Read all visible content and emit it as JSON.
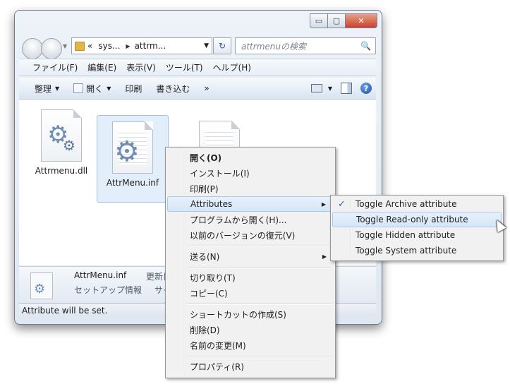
{
  "window": {
    "controls": {
      "minimize": "▭",
      "maximize": "▢",
      "close": "✕"
    }
  },
  "address": {
    "overflow": "«",
    "crumbs": [
      "sys...",
      "attrm..."
    ]
  },
  "search": {
    "placeholder": "attrmenuの検索"
  },
  "menubar": [
    "ファイル(F)",
    "編集(E)",
    "表示(V)",
    "ツール(T)",
    "ヘルプ(H)"
  ],
  "toolbar": {
    "organize": "整理",
    "open": "開く",
    "print": "印刷",
    "burn": "書き込む",
    "more": "»"
  },
  "files": [
    {
      "name": "Attrmenu.dll",
      "icon": "gear-icon"
    },
    {
      "name": "AttrMenu.inf",
      "icon": "gear-icon",
      "selected": true
    },
    {
      "name": "",
      "icon": "document-icon"
    }
  ],
  "details": {
    "name": "AttrMenu.inf",
    "type": "セットアップ情報",
    "key1": "更新日",
    "key2": "サイ"
  },
  "status": {
    "text": "Attribute will be set."
  },
  "context_menu": {
    "items": [
      "開く(O)",
      "インストール(I)",
      "印刷(P)",
      "Attributes",
      "プログラムから開く(H)...",
      "以前のバージョンの復元(V)",
      "送る(N)",
      "切り取り(T)",
      "コピー(C)",
      "ショートカットの作成(S)",
      "削除(D)",
      "名前の変更(M)",
      "プロパティ(R)"
    ]
  },
  "submenu": {
    "items": [
      {
        "label": "Toggle Archive attribute",
        "checked": true
      },
      {
        "label": "Toggle Read-only attribute",
        "checked": false
      },
      {
        "label": "Toggle Hidden attribute",
        "checked": false
      },
      {
        "label": "Toggle System attribute",
        "checked": false
      }
    ],
    "check_glyph": "✓"
  },
  "icons": {
    "arrow": "▼",
    "submenu_arrow": "▶",
    "crumb_sep": "▶",
    "refresh": "↻",
    "search": "🔍",
    "help": "?"
  }
}
